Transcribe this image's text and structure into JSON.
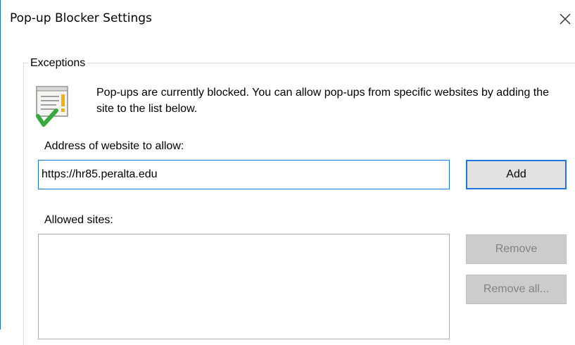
{
  "window": {
    "title": "Pop-up Blocker Settings",
    "accent_color": "#1e78d7"
  },
  "icons": {
    "close": "close-icon",
    "info": "notepad-checkmark-icon"
  },
  "exceptions": {
    "group_label": "Exceptions",
    "info_text": "Pop-ups are currently blocked.  You can allow pop-ups from specific websites by adding the site to the list below.",
    "address_label": "Address of website to allow:",
    "address_value": "https://hr85.peralta.edu",
    "add_label": "Add",
    "allowed_sites_label": "Allowed sites:",
    "allowed_sites": [],
    "remove_label": "Remove",
    "remove_all_label": "Remove all..."
  }
}
